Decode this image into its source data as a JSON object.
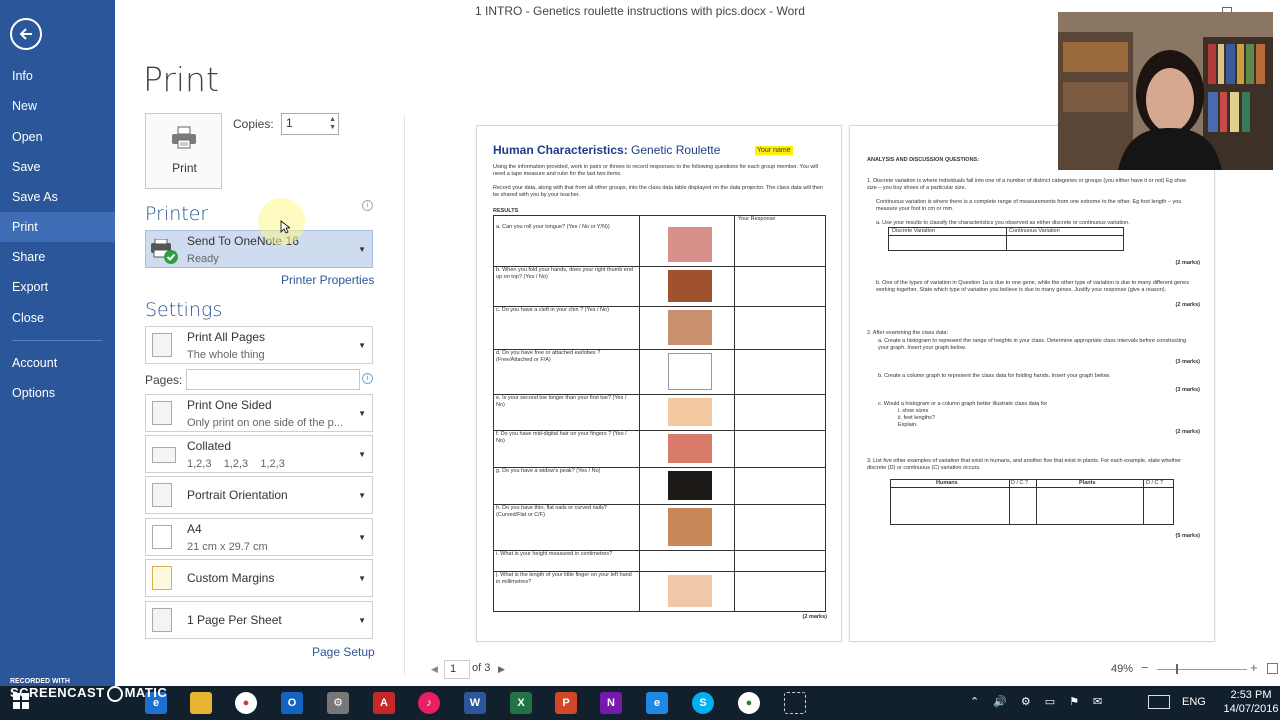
{
  "window": {
    "title": "1 INTRO - Genetics roulette instructions with pics.docx - Word"
  },
  "sidebar": {
    "items": [
      {
        "label": "Info"
      },
      {
        "label": "New"
      },
      {
        "label": "Open"
      },
      {
        "label": "Save"
      },
      {
        "label": "Save As"
      },
      {
        "label": "Print"
      },
      {
        "label": "Share"
      },
      {
        "label": "Export"
      },
      {
        "label": "Close"
      },
      {
        "label": "Account"
      },
      {
        "label": "Options"
      }
    ],
    "selected": "Print"
  },
  "print": {
    "heading": "Print",
    "print_button": "Print",
    "copies_label": "Copies:",
    "copies_value": "1",
    "printer_heading": "Printer",
    "printer_name": "Send To OneNote 16",
    "printer_status": "Ready",
    "printer_properties": "Printer Properties",
    "settings_heading": "Settings",
    "settings": [
      {
        "name": "Print All Pages",
        "sub": "The whole thing"
      },
      {
        "name": "Print One Sided",
        "sub": "Only print on one side of the p..."
      },
      {
        "name": "Collated",
        "sub": "1,2,3    1,2,3    1,2,3"
      },
      {
        "name": "Portrait Orientation",
        "sub": ""
      },
      {
        "name": "A4",
        "sub": "21 cm x 29.7 cm"
      },
      {
        "name": "Custom Margins",
        "sub": ""
      },
      {
        "name": "1 Page Per Sheet",
        "sub": ""
      }
    ],
    "pages_label": "Pages:",
    "page_setup": "Page Setup"
  },
  "preview": {
    "page_current": "1",
    "page_total": "of 3",
    "zoom": "49%",
    "page1": {
      "title_bold": "Human Characteristics:",
      "title_rest": " Genetic Roulette",
      "your_name": "Your name",
      "intro1": "Using the information provided, work in pairs or threes to record responses to the following questions for each group member. You will need a tape measure and ruler for the last two items.",
      "intro2": "Record your data, along with that from all other groups, into the class data table displayed on the data projector. The class data will then be shared with you by your teacher.",
      "results": "RESULTS",
      "col_response": "Your Response",
      "rows": [
        "a.  Can you roll your tongue? (Yes / No or Y/N))",
        "b.  When you fold your hands, does your right thumb end up on top? (Yes / No)",
        "c.  Do you have a cleft in your chin ? (Yes / No)",
        "d.  Do you have free or attached earlobes ? (Free/Attached or F/A)",
        "e.  Is your second toe longer than your first toe? (Yes / No)",
        "f.  Do you have mid-digital hair on your fingers ? (Yes / No)",
        "g.  Do you have a widow's peak? (Yes / No)",
        "h.  Do you have thin, flat nails or curved nails? (Curved/Flat or C/F)",
        "i.  What is your height measured in centimetres?",
        "j.  What is the length of your little finger on your left hand in millimetres?"
      ],
      "marks": "(2 marks)"
    },
    "page2": {
      "heading": "ANALYSIS AND DISCUSSION QUESTIONS:",
      "q1": "1.  Discrete variation is where individuals fall into one of a number of distinct categories or groups (you either have it or not) Eg shoe size – you buy shoes of a particular size.",
      "q1b": "Continuous variation is where there is a complete range of measurements from one extreme to the other. Eg foot length – you measure your foot in cm or mm.",
      "q1a": "a.  Use your results to classify the characteristics you observed as either discrete or continuous variation.",
      "discrete": "Discrete Variation",
      "continuous": "Continuous Variation",
      "q1bb": "b.  One of the types of variation in Question 1a is due to one gene, while the other type of variation is due to many different genes working together. State which type of variation you believe is due to many genes. Justify your response (give a reason).",
      "q2": "2.  After examining the class data:",
      "q2a": "a.  Create a histogram to represent the range of heights in your class. Determine appropriate class intervals before constructing your graph. Insert your graph below.",
      "q2b": "b.  Create a column graph to represent the class data for folding hands. Insert your graph below.",
      "q2c": "c.  Would a histogram or a column graph better illustrate class data for",
      "q2ci": "i.      shoe sizes",
      "q2cii": "ii.     feet lengths?",
      "q2cexp": "Explain.",
      "q3": "3.  List five other examples of variation that exist in humans, and another five that exist in plants. For each example, state whether discrete (D) or continuous (C) variation occurs.",
      "humans": "Humans",
      "plants": "Plants",
      "dc": "D / C ?",
      "marks2": "(2 marks)",
      "marks3": "(3 marks)",
      "marks5": "(5 marks)"
    }
  },
  "taskbar": {
    "time": "2:53 PM",
    "date": "14/07/2016",
    "lang": "ENG"
  },
  "watermark": {
    "line1": "RECORDED WITH",
    "line2": "SCREENCAST",
    "line3": "MATIC"
  },
  "colors": {
    "accent": "#2b579a",
    "selected_nav": "#3e6db5",
    "printer_box": "#cfdcf0"
  }
}
